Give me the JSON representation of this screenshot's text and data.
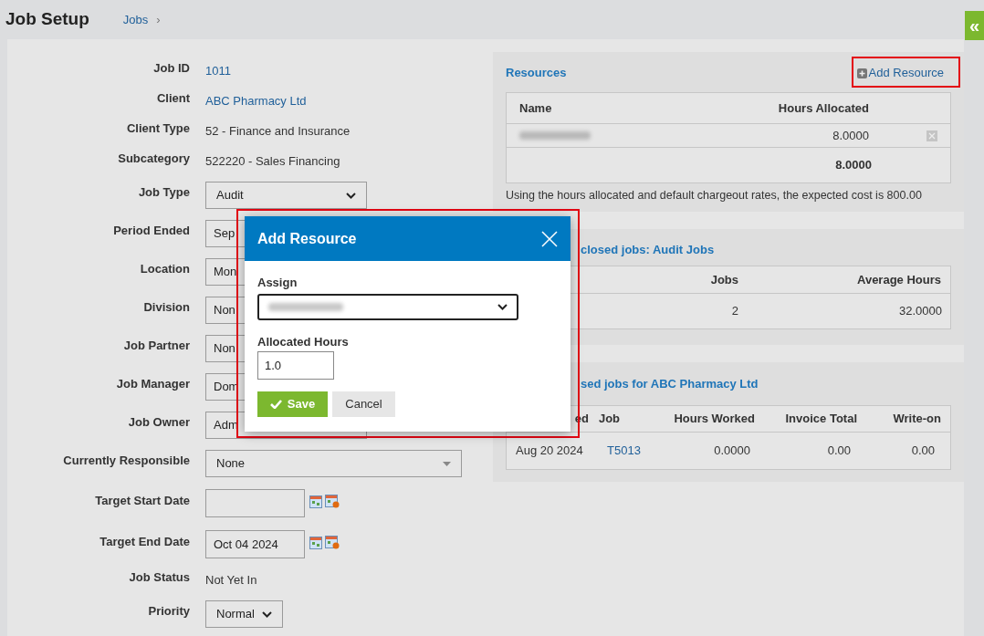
{
  "header": {
    "title": "Job Setup",
    "breadcrumb": "Jobs",
    "separator": "›"
  },
  "collapse_button": {
    "label": "«"
  },
  "form": [
    {
      "label": "Job ID",
      "kind": "link",
      "value": "1011"
    },
    {
      "label": "Client",
      "kind": "link",
      "value": "ABC Pharmacy Ltd"
    },
    {
      "label": "Client Type",
      "kind": "text",
      "value": "52 - Finance and Insurance"
    },
    {
      "label": "Subcategory",
      "kind": "text",
      "value": "522220 - Sales Financing"
    },
    {
      "label": "Job Type",
      "kind": "select",
      "value": "Audit"
    },
    {
      "label": "Period Ended",
      "kind": "covered",
      "value": "Sep"
    },
    {
      "label": "Location",
      "kind": "covered",
      "value": "Mon"
    },
    {
      "label": "Division",
      "kind": "covered",
      "value": "Non"
    },
    {
      "label": "Job Partner",
      "kind": "covered",
      "value": "Non"
    },
    {
      "label": "Job Manager",
      "kind": "covered",
      "value": "Dom"
    },
    {
      "label": "Job Owner",
      "kind": "covered",
      "value": "Adm"
    },
    {
      "label": "Currently Responsible",
      "kind": "combo",
      "value": "None"
    },
    {
      "label": "Target Start Date",
      "kind": "date"
    },
    {
      "label": "Target End Date",
      "kind": "date",
      "value": "Oct 04 2024"
    },
    {
      "label": "Job Status",
      "kind": "text",
      "value": "Not Yet In"
    },
    {
      "label": "Priority",
      "kind": "small-select",
      "value": "Normal"
    }
  ],
  "resources": {
    "title": "Resources",
    "add_button": {
      "label": "Add Resource",
      "highlighted": true
    },
    "columns": [
      "Name",
      "Hours Allocated"
    ],
    "rows": [
      {
        "name_redacted": true,
        "hours": "8.0000"
      }
    ],
    "total": "8.0000",
    "note": "Using the hours allocated and default chargeout rates, the expected cost is 800.00"
  },
  "stats": {
    "title": "closed jobs: Audit Jobs",
    "columns": [
      "Jobs",
      "Average Hours"
    ],
    "rows": [
      [
        "2",
        "32.0000"
      ]
    ]
  },
  "closed_jobs": {
    "title": "sed jobs for ABC Pharmacy Ltd",
    "columns": [
      "ed",
      "Job",
      "Hours Worked",
      "Invoice Total",
      "Write-on"
    ],
    "rows": [
      [
        "Aug 20 2024",
        "T5013",
        "0.0000",
        "0.00",
        "0.00"
      ]
    ]
  },
  "modal": {
    "title": "Add Resource",
    "highlighted": true,
    "assign_label": "Assign",
    "assign_redacted": true,
    "hours_label": "Allocated Hours",
    "hours_value": "1.0",
    "save": "Save",
    "cancel": "Cancel"
  }
}
